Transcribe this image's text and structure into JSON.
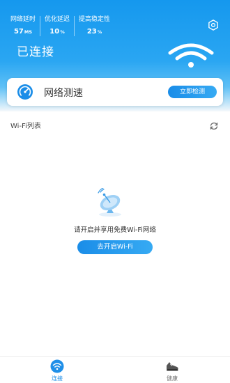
{
  "header": {
    "stats": [
      {
        "label": "网络延时",
        "value": "57",
        "unit": "MS"
      },
      {
        "label": "优化延迟",
        "value": "10",
        "unit": "%"
      },
      {
        "label": "提高稳定性",
        "value": "23",
        "unit": "%"
      }
    ],
    "status": "已连接",
    "settings_icon": "gear-icon",
    "wifi_icon": "wifi-icon"
  },
  "speed_test": {
    "title": "网络测速",
    "button_label": "立即检测",
    "icon": "speedometer-icon"
  },
  "wifi_list": {
    "title": "Wi-Fi列表",
    "refresh_icon": "refresh-icon",
    "empty_message": "请开启并享用免费Wi-Fi网络",
    "open_button_label": "去开启Wi-Fi",
    "empty_icon": "satellite-dish-icon"
  },
  "tabs": [
    {
      "label": "连接",
      "icon": "wifi-icon",
      "active": true
    },
    {
      "label": "健康",
      "icon": "shoe-icon",
      "active": false
    }
  ],
  "colors": {
    "primary": "#1a8de8",
    "header_top": "#1598ee",
    "text_dark": "#333333"
  }
}
